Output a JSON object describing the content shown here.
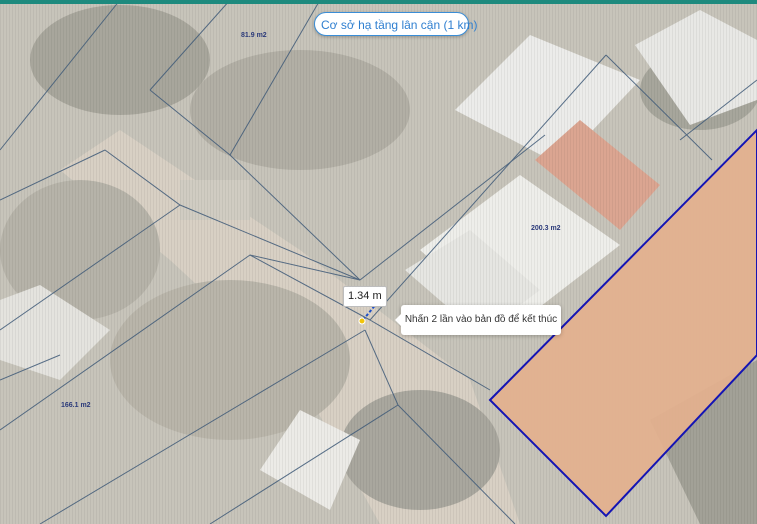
{
  "map": {
    "nearby_infrastructure_label": "Cơ sở hạ tầng lân cận (1 km)",
    "parcel_area_labels": [
      "81.9 m2",
      "200.3 m2",
      "166.1 m2"
    ],
    "measurement": {
      "distance_label": "1.34 m",
      "hint_text": "Nhấn 2 lần vào bản đồ để kết thúc"
    },
    "colors": {
      "accent_strip": "#1e8a7e",
      "button_text": "#2f7fd0",
      "parcel_boundary": "#3f5a78",
      "selected_parcel_fill": "#e3b08e",
      "selected_parcel_outline": "#1414b4",
      "measure_point": "#f2c40a",
      "measure_line": "#1d4fc9"
    }
  }
}
